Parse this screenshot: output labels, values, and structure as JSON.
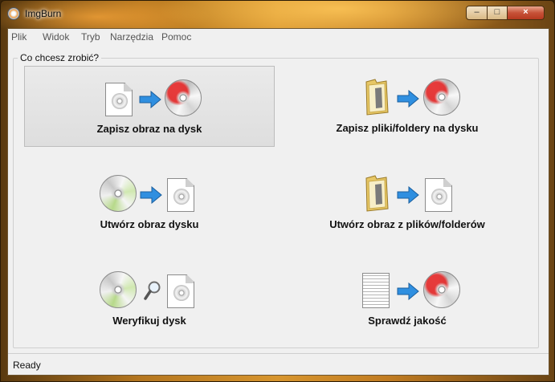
{
  "window": {
    "title": "ImgBurn",
    "controls": {
      "minimize": "–",
      "maximize": "□",
      "close": "×"
    }
  },
  "menubar": {
    "items": [
      "Plik",
      "Widok",
      "Tryb",
      "Narzędzia",
      "Pomoc"
    ]
  },
  "main": {
    "group_label": "Co chcesz zrobić?",
    "tasks": [
      {
        "label": "Zapisz obraz na dysk",
        "selected": true,
        "icons": [
          "image-file-icon",
          "arrow-right-icon",
          "burn-disc-icon"
        ]
      },
      {
        "label": "Zapisz pliki/foldery na dysku",
        "selected": false,
        "icons": [
          "folder-icon",
          "arrow-right-icon",
          "burn-disc-icon"
        ]
      },
      {
        "label": "Utwórz obraz dysku",
        "selected": false,
        "icons": [
          "disc-icon",
          "arrow-right-icon",
          "image-file-icon"
        ]
      },
      {
        "label": "Utwórz obraz z plików/folderów",
        "selected": false,
        "icons": [
          "folder-icon",
          "arrow-right-icon",
          "image-file-icon"
        ]
      },
      {
        "label": "Weryfikuj dysk",
        "selected": false,
        "icons": [
          "disc-icon",
          "magnifier-icon",
          "image-file-icon"
        ]
      },
      {
        "label": "Sprawdź jakość",
        "selected": false,
        "icons": [
          "data-file-icon",
          "arrow-right-icon",
          "burn-disc-icon"
        ]
      }
    ]
  },
  "statusbar": {
    "text": "Ready"
  },
  "colors": {
    "arrow_blue": "#2f8fe0",
    "burn_red": "#e02828",
    "folder_yellow": "#e7c766",
    "selection_bg": "#e3e3e3"
  }
}
